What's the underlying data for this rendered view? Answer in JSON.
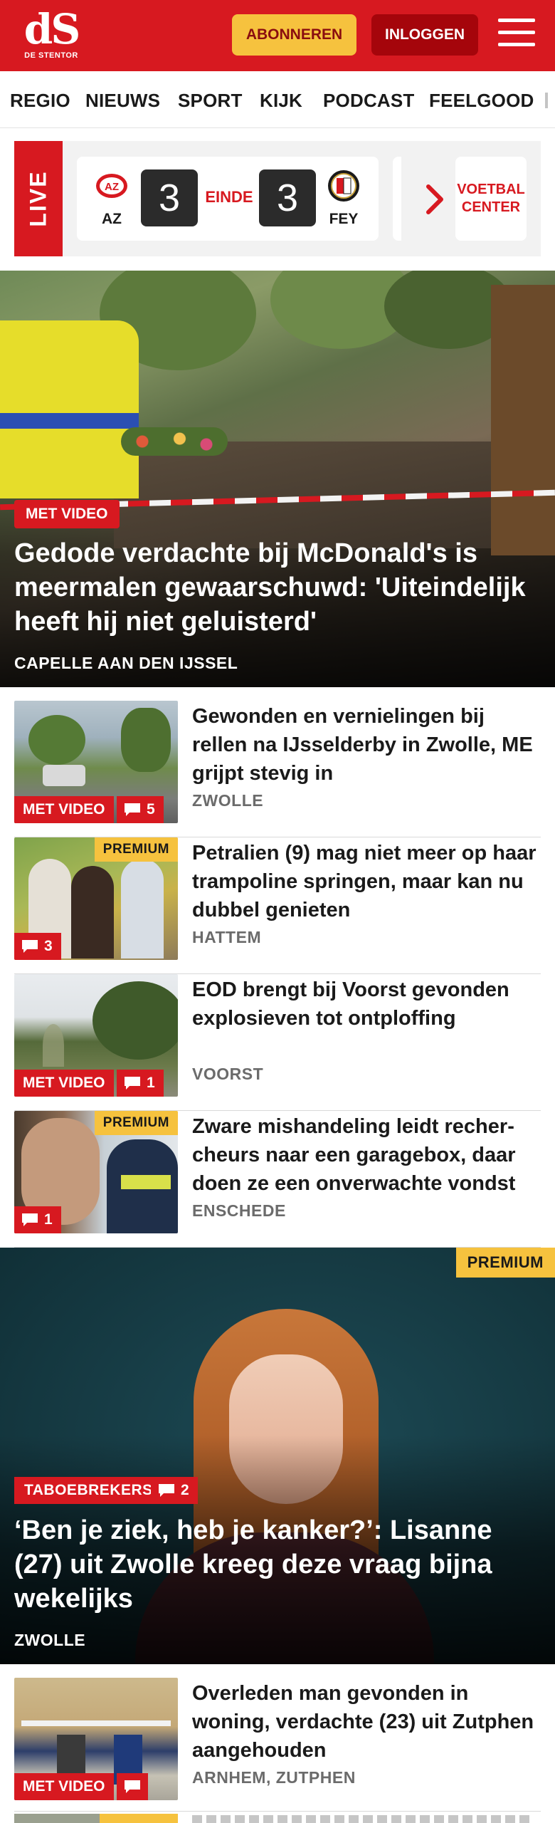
{
  "header": {
    "logo_mark": "dS",
    "logo_text": "DE STENTOR",
    "subscribe_label": "ABONNEREN",
    "login_label": "INLOGGEN",
    "menu_icon": "hamburger-menu-icon",
    "brand_red": "#d71920",
    "accent_yellow": "#f6c23e"
  },
  "nav": {
    "items": [
      "REGIO",
      "NIEUWS",
      "SPORT",
      "KIJK",
      "PODCAST",
      "FEELGOOD"
    ]
  },
  "live": {
    "label": "LIVE",
    "match": {
      "home": "AZ",
      "home_score": "3",
      "status": "EINDE",
      "away_score": "3",
      "away": "FEY"
    },
    "arrow_icon": "chevron-right-icon",
    "center_label_line1": "VOETBAL",
    "center_label_line2": "CENTER"
  },
  "hero": {
    "badge": "MET VIDEO",
    "title": "Gedode verdachte bij McDonald's is meermalen gewaarschuwd: 'Uiteinde­lijk heeft hij niet geluisterd'",
    "location": "CAPELLE AAN DEN IJSSEL"
  },
  "articles": [
    {
      "title": "Gewonden en vernielingen bij rellen na IJsselderby in Zwolle, ME grijpt stevig in",
      "location": "ZWOLLE",
      "video_label": "MET VIDEO",
      "comments": "5"
    },
    {
      "title": "Petralien (9) mag niet meer op haar trampoline springen, maar kan nu dubbel genieten",
      "location": "HATTEM",
      "premium_label": "PREMIUM",
      "comments": "3"
    },
    {
      "title": "EOD brengt bij Voorst gevonden explosieven tot ontploffing",
      "location": "VOORST",
      "video_label": "MET VIDEO",
      "comments": "1"
    },
    {
      "title": "Zware mishandeling leidt recher­cheurs naar een garagebox, daar doen ze een onverwachte vondst",
      "location": "ENSCHEDE",
      "premium_label": "PREMIUM",
      "comments": "1"
    }
  ],
  "feature": {
    "premium_label": "PREMIUM",
    "tag": "TABOEBREKERS",
    "comments": "2",
    "title": "‘Ben je ziek, heb je kanker?’: Lisanne (27) uit Zwolle kreeg deze vraag bijna wekelijks",
    "location": "ZWOLLE"
  },
  "article_last": {
    "title": "Overleden man gevonden in woning, verdachte (23) uit Zutphen aangehouden",
    "location": "ARNHEM, ZUTPHEN",
    "video_label": "MET VIDEO"
  }
}
